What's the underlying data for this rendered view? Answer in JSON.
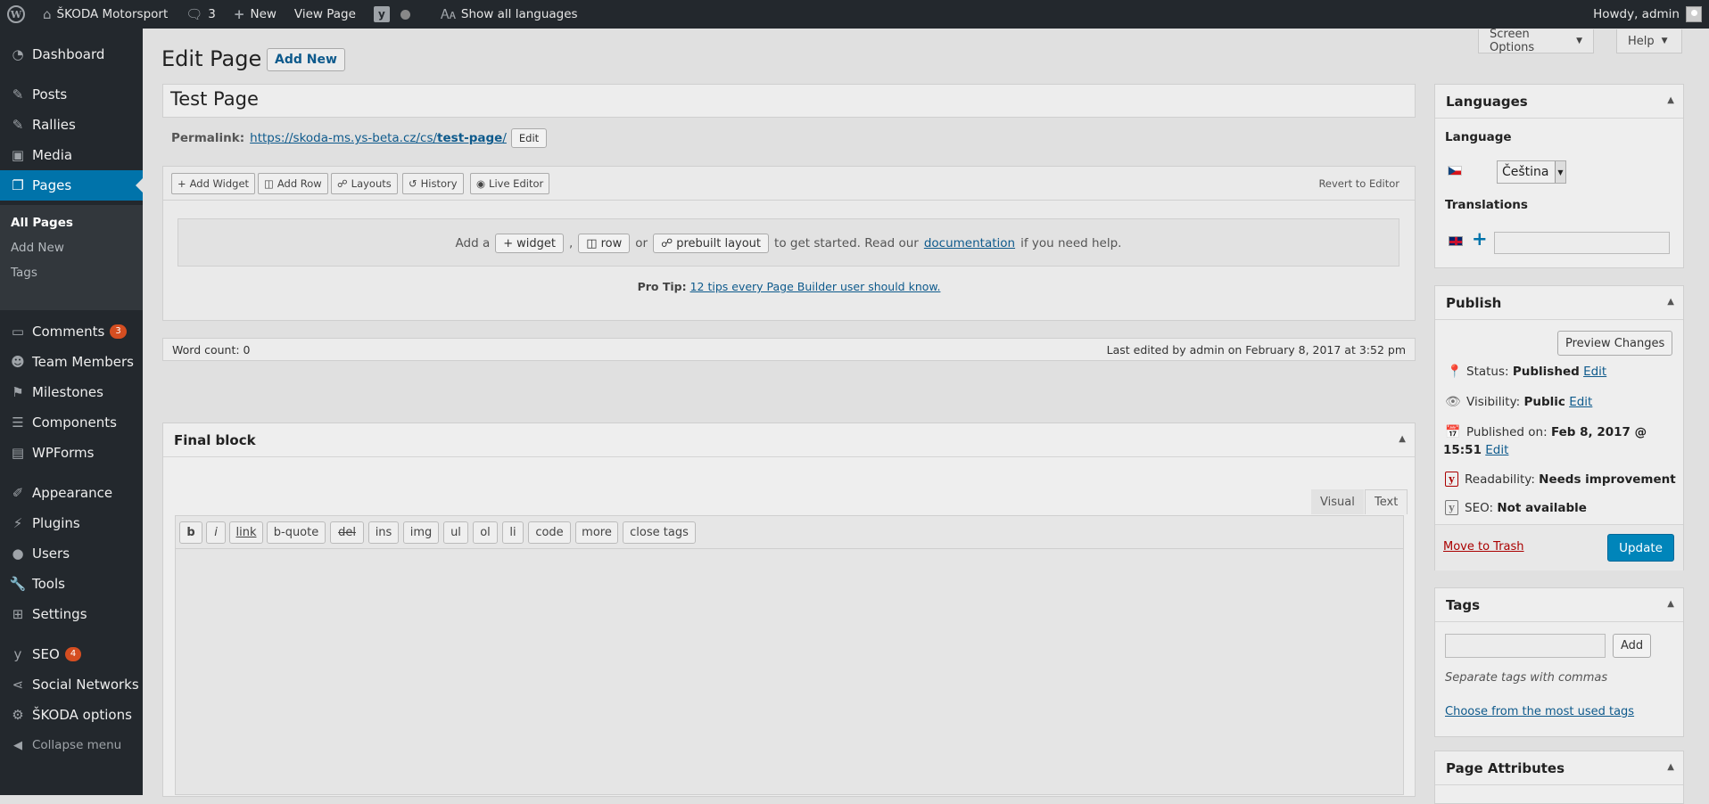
{
  "adminbar": {
    "site_name": "ŠKODA Motorsport",
    "comments_count": "3",
    "new_label": "New",
    "view_page_label": "View Page",
    "languages_label": "Show all languages",
    "howdy": "Howdy, admin"
  },
  "sidebar": {
    "dashboard": "Dashboard",
    "posts": "Posts",
    "rallies": "Rallies",
    "media": "Media",
    "pages": "Pages",
    "pages_sub": {
      "all": "All Pages",
      "add_new": "Add New",
      "tags": "Tags"
    },
    "comments": "Comments",
    "comments_badge": "3",
    "team_members": "Team Members",
    "milestones": "Milestones",
    "components": "Components",
    "wpforms": "WPForms",
    "appearance": "Appearance",
    "plugins": "Plugins",
    "users": "Users",
    "tools": "Tools",
    "settings": "Settings",
    "seo": "SEO",
    "seo_badge": "4",
    "social": "Social Networks",
    "skoda_options": "ŠKODA options",
    "collapse": "Collapse menu"
  },
  "header": {
    "title": "Edit Page",
    "add_new": "Add New",
    "screen_options": "Screen Options",
    "help": "Help"
  },
  "post": {
    "title": "Test Page",
    "permalink_label": "Permalink:",
    "permalink_base": "https://skoda-ms.ys-beta.cz/cs/",
    "permalink_slug": "test-page",
    "permalink_tail": "/",
    "permalink_edit": "Edit"
  },
  "page_builder": {
    "add_widget": "Add Widget",
    "add_row": "Add Row",
    "layouts": "Layouts",
    "history": "History",
    "live_editor": "Live Editor",
    "revert": "Revert to Editor",
    "add_a": "Add a",
    "widget": "widget",
    "comma": ",",
    "row": "row",
    "or": "or",
    "prebuilt": "prebuilt layout",
    "started": "to get started. Read our",
    "documentation": "documentation",
    "need_help": "if you need help.",
    "pro_tip_label": "Pro Tip:",
    "pro_tip_link": "12 tips every Page Builder user should know."
  },
  "status_bar": {
    "word_count": "Word count: 0",
    "last_edited": "Last edited by admin on February 8, 2017 at 3:52 pm"
  },
  "final_block": {
    "title": "Final block",
    "tab_visual": "Visual",
    "tab_text": "Text",
    "quicktags": [
      "b",
      "i",
      "link",
      "b-quote",
      "del",
      "ins",
      "img",
      "ul",
      "ol",
      "li",
      "code",
      "more",
      "close tags"
    ]
  },
  "languages_box": {
    "title": "Languages",
    "language_label": "Language",
    "selected_language": "Čeština",
    "translations_label": "Translations",
    "translation_value": ""
  },
  "publish_box": {
    "title": "Publish",
    "preview": "Preview Changes",
    "status_label": "Status:",
    "status_value": "Published",
    "visibility_label": "Visibility:",
    "visibility_value": "Public",
    "published_label": "Published on:",
    "published_value_1": "Feb 8, 2017 @",
    "published_value_2": "15:51",
    "readability_label": "Readability:",
    "readability_value": "Needs improvement",
    "seo_label": "SEO:",
    "seo_value": "Not available",
    "edit": "Edit",
    "trash": "Move to Trash",
    "update": "Update"
  },
  "tags_box": {
    "title": "Tags",
    "input_value": "",
    "add": "Add",
    "hint": "Separate tags with commas",
    "choose": "Choose from the most used tags"
  },
  "page_attributes_box": {
    "title": "Page Attributes"
  },
  "colors": {
    "adminbar_bg": "#23282d",
    "menu_current": "#0073aa",
    "update_button": "#0085ba",
    "badge": "#d54e21",
    "trash_link": "#a00"
  }
}
